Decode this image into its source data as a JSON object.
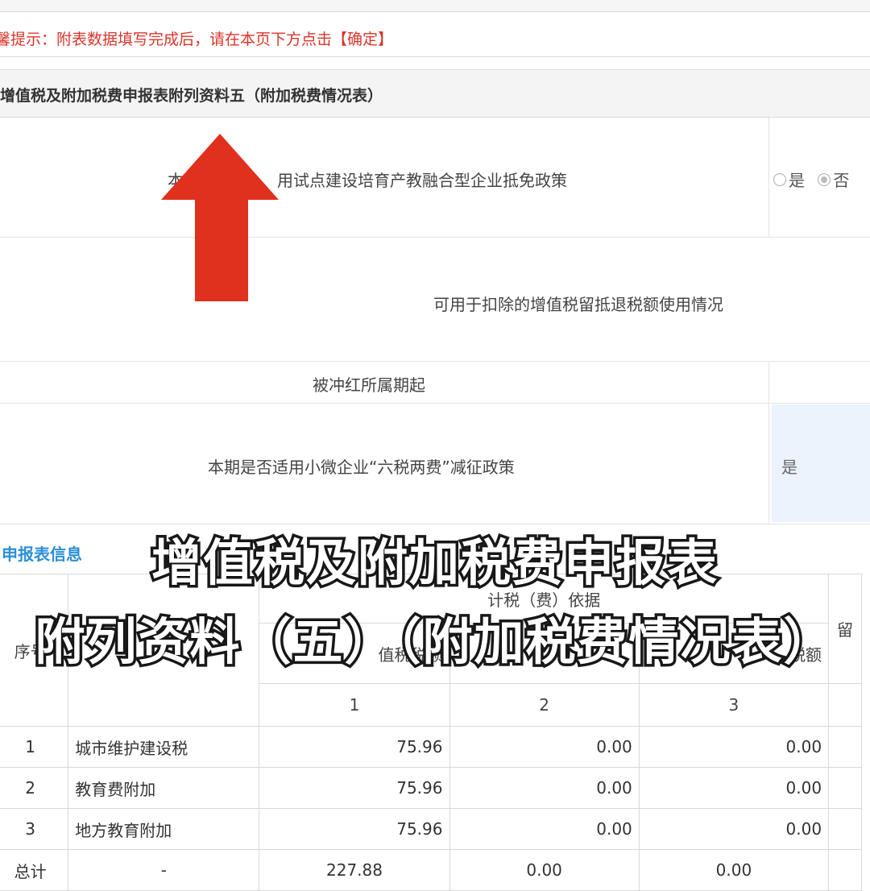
{
  "top_strip": {
    "cut_text": ""
  },
  "notice": {
    "text": "馨提示：附表数据填写完成后，请在本页下方点击【确定】"
  },
  "section": {
    "title": "增值税及附加税费申报表附列资料五（附加税费情况表）"
  },
  "rows": {
    "policy_pilot": "本期是否适用试点建设培育产教融合型企业抵免政策",
    "policy_pilot_visible": "用试点建设培育产教融合型企业抵免政策",
    "policy_pilot_lead": "本",
    "radio_yes": "是",
    "radio_no": "否",
    "deductible_refund": "可用于扣除的增值税留抵退税额使用情况",
    "reversal_period_start": "被冲红所属期起",
    "small_micro_policy": "本期是否适用小微企业“六税两费”减征政策",
    "small_micro_value": "是"
  },
  "subhead": "申报表信息",
  "table": {
    "header_group": "计税（费）依据",
    "col_seq": "序号",
    "col_1_label": "值税税额",
    "col_3_label": "税额",
    "col_last": "留",
    "col_nums": [
      "1",
      "2",
      "3"
    ],
    "rows": [
      {
        "seq": "1",
        "name": "城市维护建设税",
        "c1": "75.96",
        "c2": "0.00",
        "c3": "0.00"
      },
      {
        "seq": "2",
        "name": "教育费附加",
        "c1": "75.96",
        "c2": "0.00",
        "c3": "0.00"
      },
      {
        "seq": "3",
        "name": "地方教育附加",
        "c1": "75.96",
        "c2": "0.00",
        "c3": "0.00"
      }
    ],
    "total": {
      "label": "总计",
      "name": "-",
      "c1": "227.88",
      "c2": "0.00",
      "c3": "0.00"
    }
  },
  "overlay": {
    "line1": "增值税及附加税费申报表",
    "line2": "附列资料（五）（附加税费情况表）"
  },
  "colors": {
    "notice_red": "#d9342a",
    "arrow_red": "#e0301e",
    "subhead_blue": "#2c8fd8",
    "select_bg": "#edf3fc"
  }
}
